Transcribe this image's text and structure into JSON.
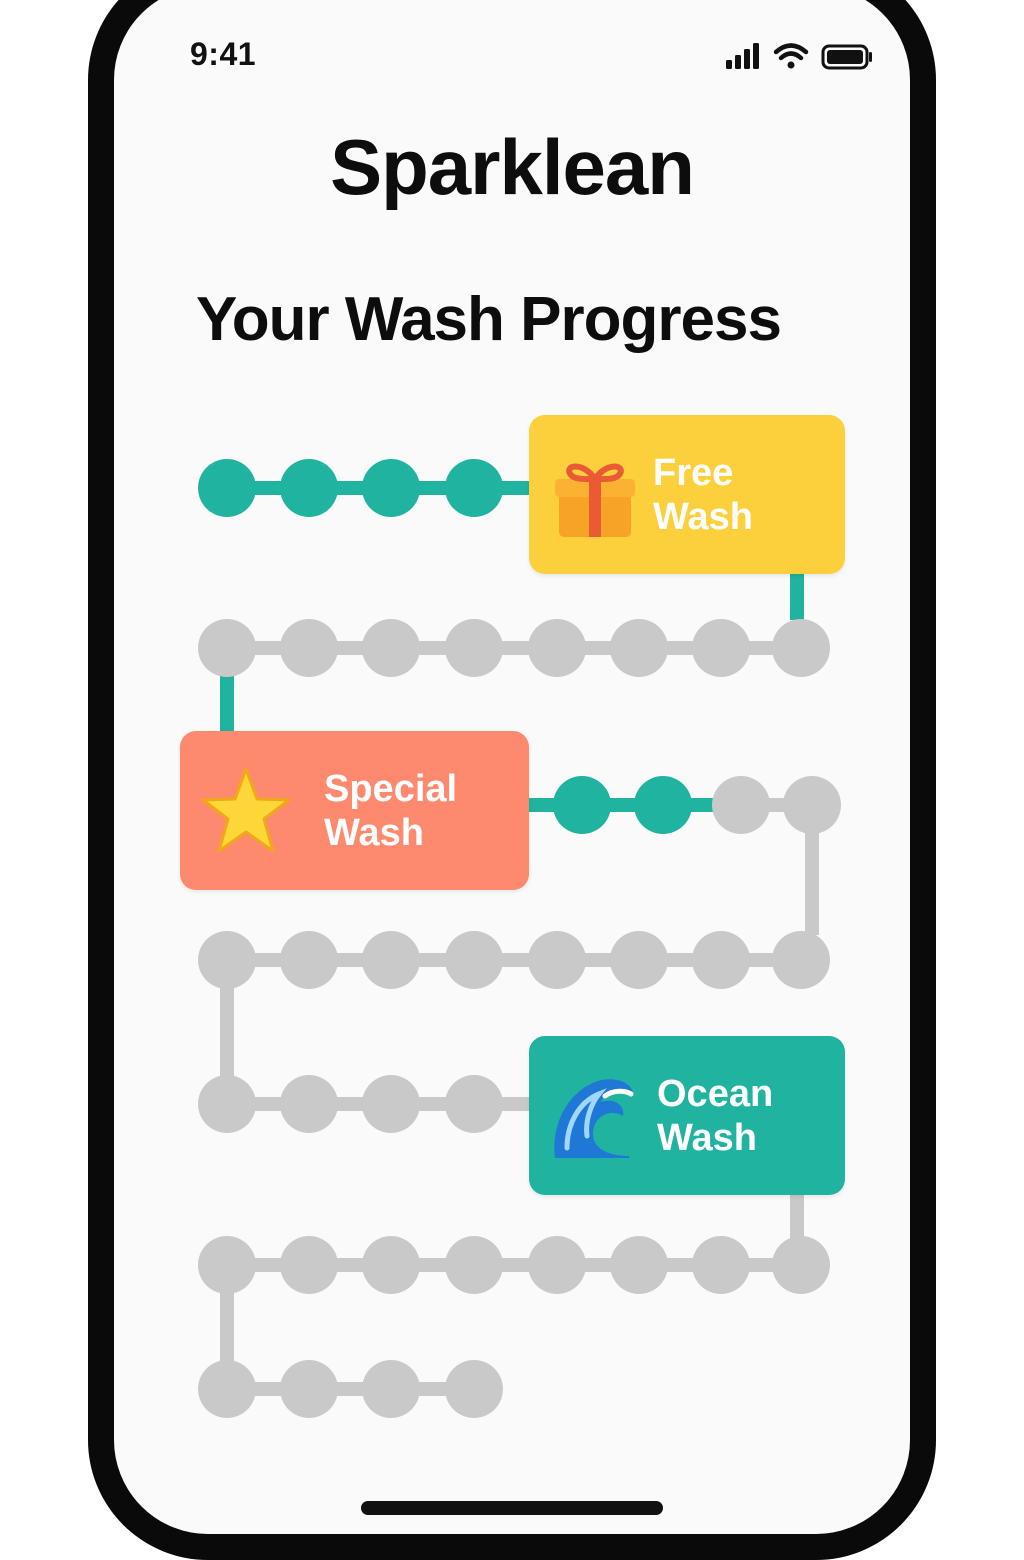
{
  "status_bar": {
    "time": "9:41",
    "icons": [
      "signal-icon",
      "wifi-icon",
      "battery-icon"
    ]
  },
  "app": {
    "title": "Sparklean"
  },
  "progress": {
    "heading": "Your Wash Progress",
    "washes_completed": 7,
    "colors": {
      "completed": "#1fb3a0",
      "pending": "#c9c9c9",
      "accent_yellow": "#fbd03c",
      "accent_coral": "#fd8a6e"
    },
    "rewards": [
      {
        "id": "free",
        "label": "Free Wash",
        "icon": "gift-icon",
        "color": "#fbd03c"
      },
      {
        "id": "special",
        "label": "Special Wash",
        "icon": "star-icon",
        "color": "#fd8a6e"
      },
      {
        "id": "ocean",
        "label": "Ocean Wash",
        "icon": "wave-icon",
        "color": "#1fb3a0"
      }
    ]
  }
}
